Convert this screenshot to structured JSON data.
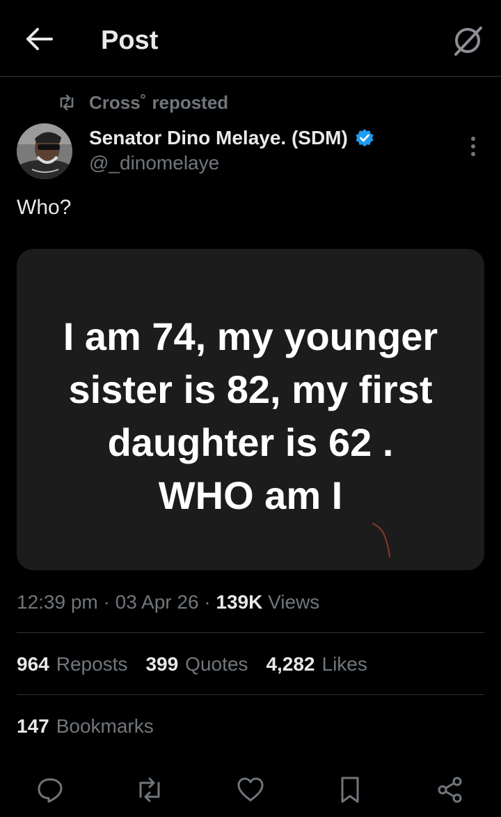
{
  "header": {
    "title": "Post"
  },
  "repost": {
    "user": "Cross˚",
    "label": "reposted"
  },
  "author": {
    "name": "Senator Dino Melaye. (SDM)",
    "handle": "@_dinomelaye",
    "verified_color": "#1d9bf0"
  },
  "post": {
    "text": "Who?",
    "image_text": "I am 74, my  younger\nsister is 82, my first\ndaughter is  62 .\nWHO am I"
  },
  "meta": {
    "time": "12:39 pm",
    "sep1": "·",
    "date": "03 Apr 26",
    "sep2": "·",
    "views_count": "139K",
    "views_label": "Views"
  },
  "stats": {
    "reposts_count": "964",
    "reposts_label": "Reposts",
    "quotes_count": "399",
    "quotes_label": "Quotes",
    "likes_count": "4,282",
    "likes_label": "Likes",
    "bookmarks_count": "147",
    "bookmarks_label": "Bookmarks"
  },
  "actions": {
    "icons": [
      "reply-icon",
      "repost-icon",
      "like-icon",
      "bookmark-icon",
      "share-icon"
    ]
  },
  "colors": {
    "background": "#000000",
    "text_primary": "#e7e9ea",
    "text_secondary": "#71767b",
    "divider": "#2f3336",
    "card_background": "#1c1c1c"
  }
}
